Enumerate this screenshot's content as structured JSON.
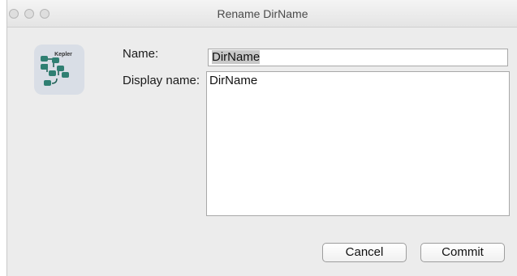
{
  "window": {
    "title": "Rename DirName"
  },
  "app_icon": {
    "name": "kepler-logo-icon",
    "text": "Kepler"
  },
  "form": {
    "name_label": "Name:",
    "name_value": "DirName",
    "display_name_label": "Display name:",
    "display_name_value": "DirName"
  },
  "buttons": {
    "cancel_label": "Cancel",
    "commit_label": "Commit"
  },
  "colors": {
    "window_bg": "#ececec",
    "icon_bg": "#d9dee6",
    "icon_node": "#2f7f72",
    "selection": "#c8c8c8"
  }
}
